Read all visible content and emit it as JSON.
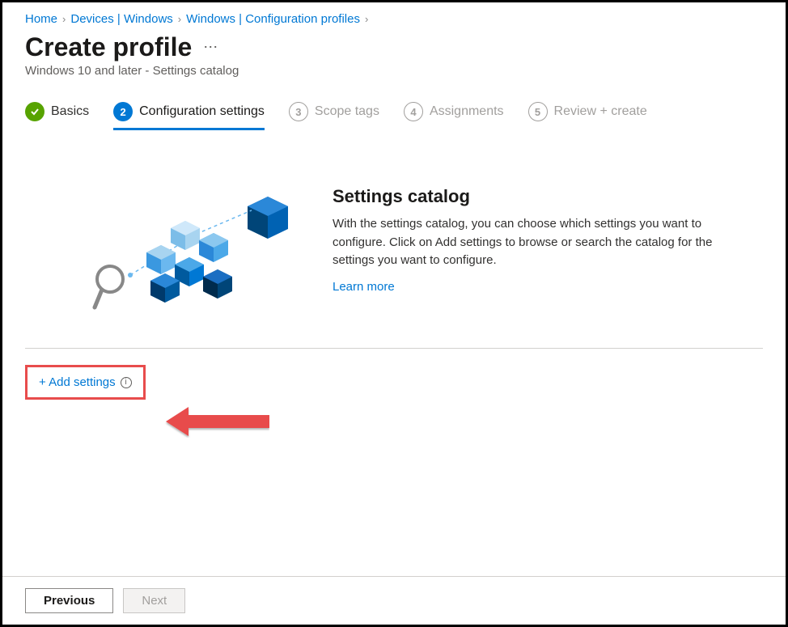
{
  "breadcrumb": {
    "home": "Home",
    "devices": "Devices | Windows",
    "config": "Windows | Configuration profiles"
  },
  "page": {
    "title": "Create profile",
    "subtitle": "Windows 10 and later - Settings catalog"
  },
  "steps": {
    "s1": {
      "num": "✓",
      "label": "Basics"
    },
    "s2": {
      "num": "2",
      "label": "Configuration settings"
    },
    "s3": {
      "num": "3",
      "label": "Scope tags"
    },
    "s4": {
      "num": "4",
      "label": "Assignments"
    },
    "s5": {
      "num": "5",
      "label": "Review + create"
    }
  },
  "info": {
    "heading": "Settings catalog",
    "body": "With the settings catalog, you can choose which settings you want to configure. Click on Add settings to browse or search the catalog for the settings you want to configure.",
    "learn": "Learn more"
  },
  "add_settings": "+ Add settings",
  "footer": {
    "previous": "Previous",
    "next": "Next"
  }
}
